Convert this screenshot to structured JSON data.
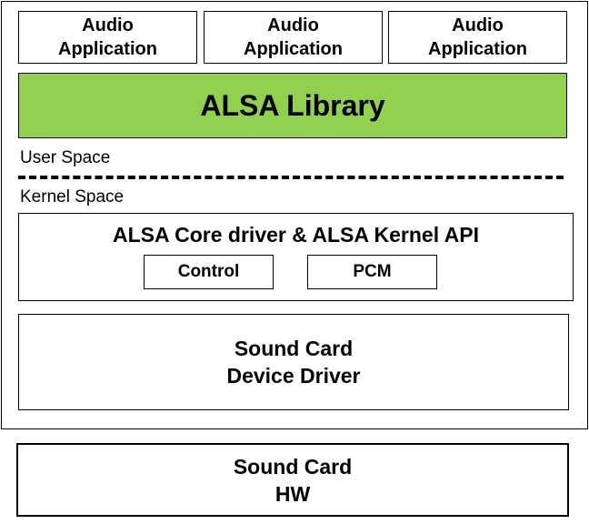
{
  "applications": [
    {
      "label": "Audio\nApplication"
    },
    {
      "label": "Audio\nApplication"
    },
    {
      "label": "Audio\nApplication"
    }
  ],
  "library": {
    "label": "ALSA Library",
    "color": "#92d050"
  },
  "boundary": {
    "user_space_label": "User Space",
    "kernel_space_label": "Kernel Space"
  },
  "core": {
    "title": "ALSA Core driver & ALSA Kernel API",
    "modules": [
      {
        "label": "Control"
      },
      {
        "label": "PCM"
      }
    ]
  },
  "driver": {
    "label": "Sound Card\nDevice Driver"
  },
  "hardware": {
    "label": "Sound Card\nHW"
  }
}
